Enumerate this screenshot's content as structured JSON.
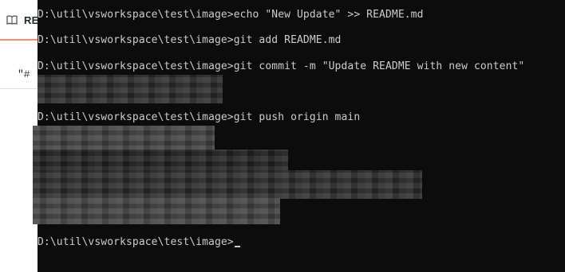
{
  "background_window": {
    "tab_label": "RE",
    "snippet": "\"#"
  },
  "terminal": {
    "lines": [
      "D:\\util\\vsworkspace\\test\\image>echo \"New Update\" >> README.md",
      "D:\\util\\vsworkspace\\test\\image>git add README.md",
      "D:\\util\\vsworkspace\\test\\image>git commit -m \"Update README with new content\"",
      "D:\\util\\vsworkspace\\test\\image>git push origin main",
      "D:\\util\\vsworkspace\\test\\image>"
    ]
  },
  "colors": {
    "terminal_bg": "#0c0c0c",
    "terminal_fg": "#cccccc",
    "tab_underline": "#fd8c73"
  }
}
